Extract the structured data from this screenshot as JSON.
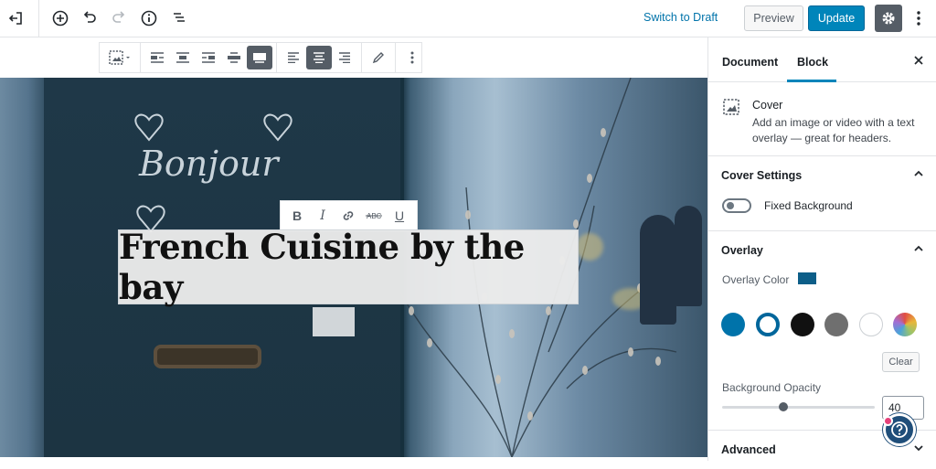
{
  "topbar": {
    "switch_draft": "Switch to Draft",
    "preview": "Preview",
    "update": "Update"
  },
  "editor": {
    "heading": "French Cuisine by the bay",
    "chalk_text": "Bonjour"
  },
  "sidebar": {
    "tabs": [
      "Document",
      "Block"
    ],
    "active_tab": "Block",
    "block": {
      "name": "Cover",
      "description": "Add an image or video with a text overlay — great for headers."
    },
    "cover_settings": {
      "title": "Cover Settings",
      "fixed_background_label": "Fixed Background",
      "fixed_background": false
    },
    "overlay": {
      "title": "Overlay",
      "color_label": "Overlay Color",
      "selected_color": "#0d5e88",
      "palette": [
        "#0073aa",
        "#00669b",
        "#111111",
        "#6f6f6f",
        "#ffffff",
        "gradient"
      ],
      "clear_label": "Clear",
      "opacity_label": "Background Opacity",
      "opacity_value": "40",
      "opacity": 0.4
    },
    "advanced": {
      "title": "Advanced"
    }
  },
  "colors": {
    "accent": "#0085ba",
    "link": "#0073aa",
    "dark": "#555d66"
  }
}
